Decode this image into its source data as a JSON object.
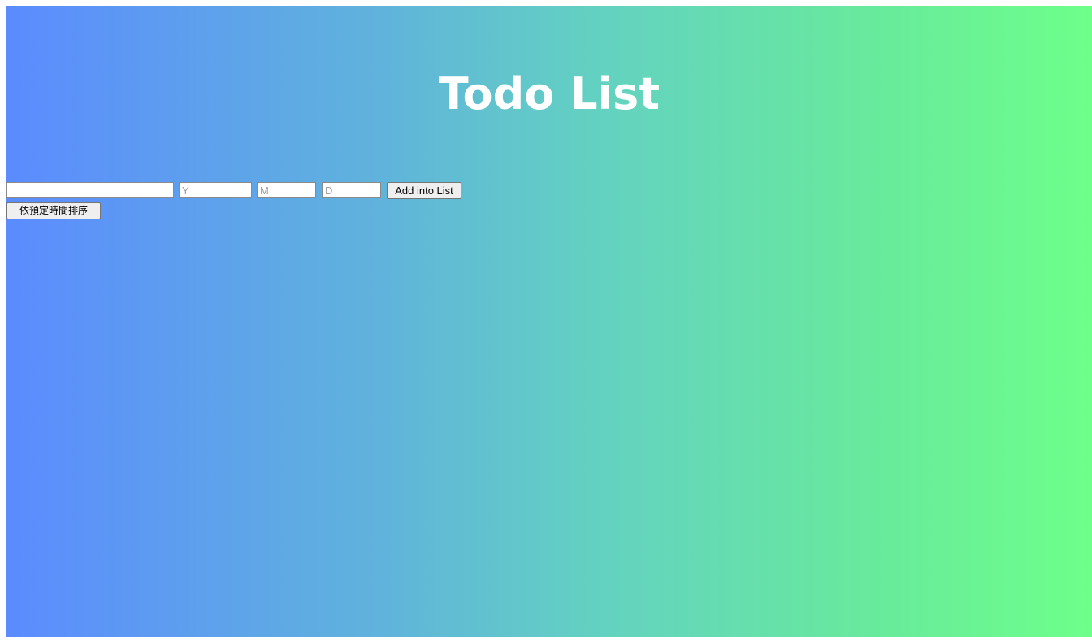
{
  "page": {
    "title": "Todo List"
  },
  "form": {
    "task_input": {
      "value": "",
      "placeholder": ""
    },
    "year_input": {
      "value": "",
      "placeholder": "Y"
    },
    "month_input": {
      "value": "",
      "placeholder": "M"
    },
    "day_input": {
      "value": "",
      "placeholder": "D"
    },
    "add_button_label": "Add into List",
    "sort_button_label": "依預定時間排序"
  },
  "colors": {
    "gradient_left": "#5b8bff",
    "gradient_right": "#6dff8a",
    "title_text": "#ffffff"
  }
}
